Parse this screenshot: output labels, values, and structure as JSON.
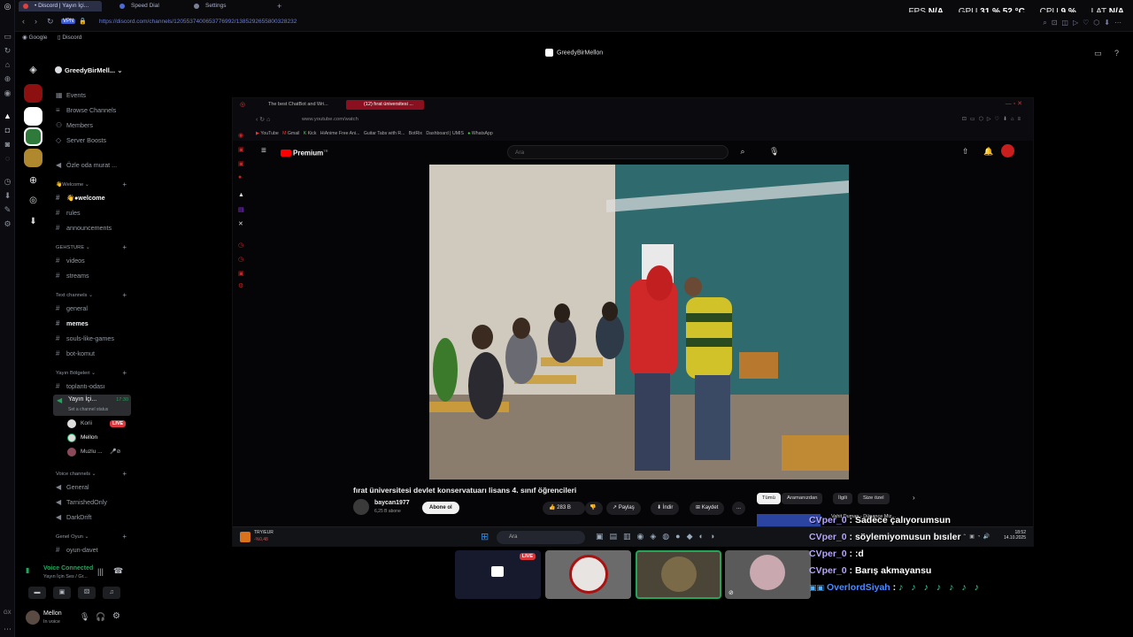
{
  "browser": {
    "tabs": [
      {
        "label": "• Discord | Yayın İçi...",
        "active": true
      },
      {
        "label": "Speed Dial",
        "active": false
      },
      {
        "label": "Settings",
        "active": false
      }
    ],
    "new_tab": "+",
    "url": "https://discord.com/channels/1205537400653776992/1385292655800328232",
    "vpn_label": "VPN",
    "bookmarks": [
      "Google",
      "Discord"
    ]
  },
  "hud": {
    "fps_label": "FPS",
    "fps_value": "N/A",
    "gpu_label": "GPU",
    "gpu_value": "31 % 52 °C",
    "cpu_label": "CPU",
    "cpu_value": "9 %",
    "lat_label": "LAT",
    "lat_value": "N/A"
  },
  "discord": {
    "server_name": "GreedyBirMell...",
    "top_items": [
      "Events",
      "Browse Channels",
      "Members",
      "Server Boosts"
    ],
    "voice_top": "Özle oda murat ...",
    "categories": {
      "welcome": "Welcome",
      "gehsture": "GEHSTURE",
      "text": "Text channels",
      "yayin": "Yayın Bölgeleri",
      "voice": "Voice channels",
      "genel_oyun": "Genel Oyun"
    },
    "channels": {
      "welcome": "welcome",
      "rules": "rules",
      "announcements": "announcements",
      "videos": "videos",
      "streams": "streams",
      "general": "general",
      "memes": "memes",
      "souls": "souls-like-games",
      "bot": "bot-komut",
      "toplanti": "toplantı-odası",
      "yayin_ici": "Yayın İçi...",
      "yayin_time": "17:30",
      "yayin_status": "Set a channel status",
      "v_general": "General",
      "v_tarnished": "TarnishedOnly",
      "v_darkdrift": "DarkDrift",
      "oyun_davet": "oyun-davet"
    },
    "voice_users": [
      {
        "name": "Korii",
        "live": "LIVE"
      },
      {
        "name": "Mellon",
        "live": ""
      },
      {
        "name": "Muzlu ...",
        "live": ""
      }
    ],
    "voice_panel": {
      "status": "Voice Connected",
      "channel": "Yayın İçin Ses / Gr..."
    },
    "user_panel": {
      "name": "Mellon",
      "status": "In voice"
    },
    "stream_title": "GreedyBirMellon",
    "tile_live": "LIVE"
  },
  "stream": {
    "inner_tabs": [
      "The best ChatBot and Wri...",
      "(12) fırat üniversitesi ..."
    ],
    "inner_url": "www.youtube.com/watch",
    "inner_bookmarks": [
      "YouTube",
      "Gmail",
      "Kick",
      "HiAnime Free Ani...",
      "Guitar Tabs with R...",
      "BotRix",
      "Dashboard | UMIS",
      "WhatsApp"
    ],
    "yt_logo": "Premium",
    "yt_logo_sup": "TR",
    "search_placeholder": "Ara",
    "video_title": "fırat üniversitesi devlet konservatuarı lisans 4. sınıf öğrencileri",
    "channel": "baycan1977",
    "subscribers": "6,25 B abone",
    "subscribe": "Abone ol",
    "likes": "283 B",
    "share": "Paylaş",
    "download": "İndir",
    "save": "Kaydet",
    "more": "...",
    "chips": [
      "Tümü",
      "Aramanızdan",
      "İlgili",
      "Size özel"
    ],
    "rec_title": "Vahit Duman - Dünance Miz...",
    "taskbar_search": "Ara",
    "currency": "TRY/EUR",
    "currency_value": "-%0,48",
    "clock_time": "18:52",
    "clock_date": "14.10.2025"
  },
  "chat": [
    {
      "user": "CVper_0",
      "text": " : Sadece çalıyorumsun"
    },
    {
      "user": "CVper_0",
      "text": " : söylemiyomusun bısıler"
    },
    {
      "user": "CVper_0",
      "text": " : :d"
    },
    {
      "user": "CVper_0",
      "text": " : Barış akmayansu"
    },
    {
      "user": "OverlordSiyah",
      "text": " : "
    }
  ],
  "bottom_left": "GX"
}
